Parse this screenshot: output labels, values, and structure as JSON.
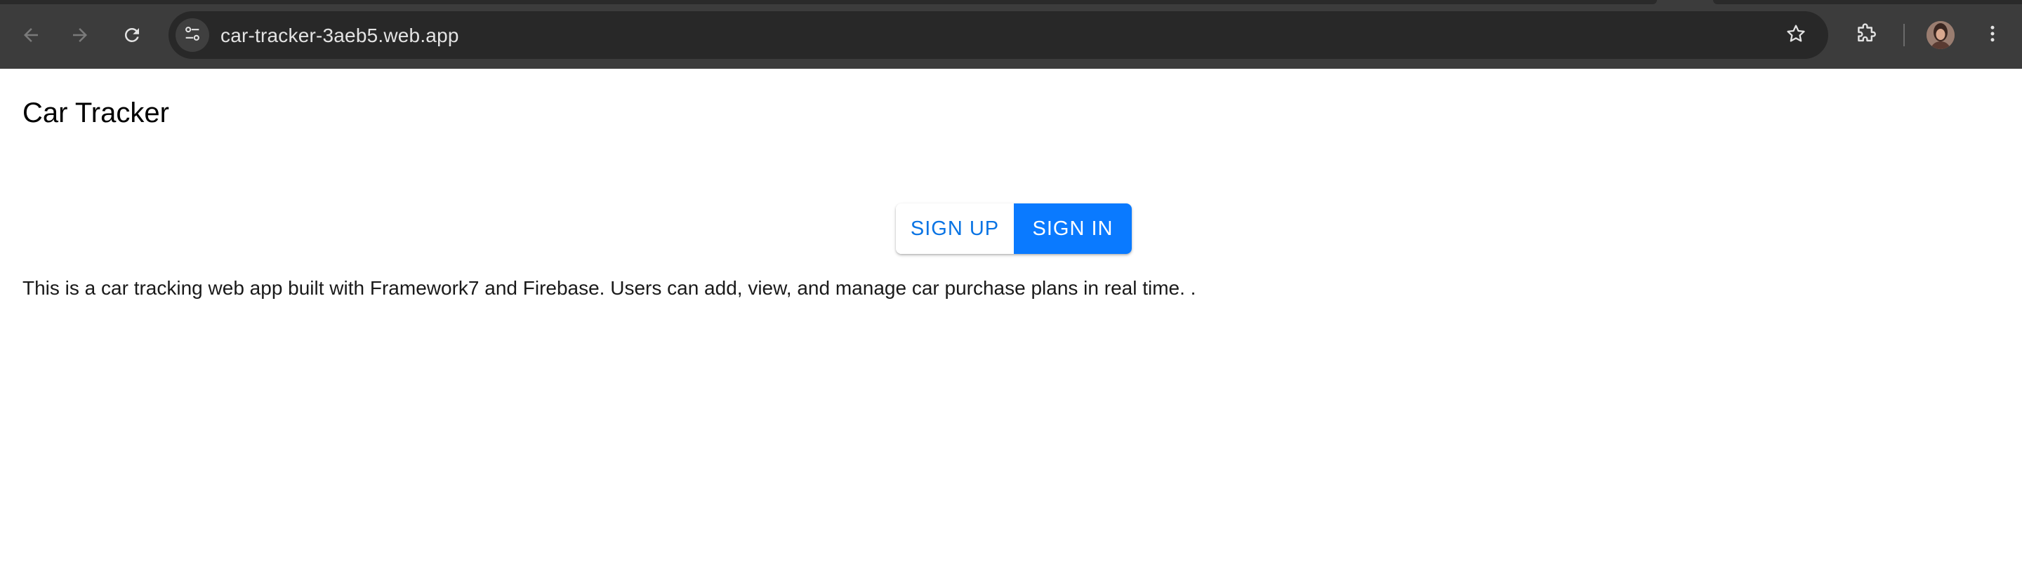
{
  "browser": {
    "url": "car-tracker-3aeb5.web.app",
    "icons": {
      "back": "arrow-left-icon",
      "forward": "arrow-right-icon",
      "reload": "reload-icon",
      "site_info": "tune-icon",
      "bookmark": "star-icon",
      "extensions": "puzzle-icon",
      "profile": "avatar",
      "menu": "kebab-menu-icon"
    }
  },
  "page": {
    "title": "Car Tracker",
    "buttons": {
      "sign_up": "SIGN UP",
      "sign_in": "SIGN IN"
    },
    "description": "This is a car tracking web app built with Framework7 and Firebase. Users can add, view, and manage car purchase plans in real time. ."
  },
  "colors": {
    "chrome": "#3c3c3c",
    "omnibox": "#282828",
    "accent": "#0a7aff"
  }
}
